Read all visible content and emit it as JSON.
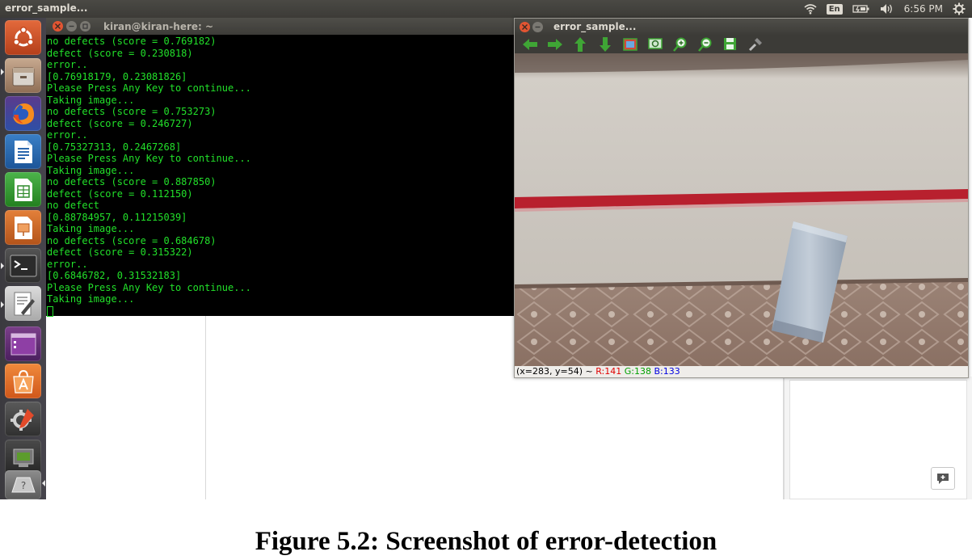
{
  "top_panel": {
    "title": "error_sample...",
    "language": "En",
    "time": "6:56 PM",
    "icons": [
      "wifi-icon",
      "keyboard-icon",
      "battery-icon",
      "volume-icon",
      "settings-gear-icon"
    ]
  },
  "launcher": {
    "items": [
      "ubuntu-dash-icon",
      "files-icon",
      "firefox-icon",
      "writer-icon",
      "calc-icon",
      "impress-icon",
      "terminal-icon",
      "text-editor-icon",
      "workspaces-icon",
      "software-center-icon",
      "system-settings-icon",
      "usb-device-icon",
      "help-icon"
    ]
  },
  "terminal": {
    "title": "kiran@kiran-here: ~",
    "lines": [
      "no defects (score = 0.769182)",
      "defect (score = 0.230818)",
      "error..",
      "[0.76918179, 0.23081826]",
      "Please Press Any Key to continue...",
      "Taking image...",
      "no defects (score = 0.753273)",
      "defect (score = 0.246727)",
      "error..",
      "[0.75327313, 0.2467268]",
      "Please Press Any Key to continue...",
      "Taking image...",
      "no defects (score = 0.887850)",
      "defect (score = 0.112150)",
      "no defect",
      "[0.88784957, 0.11215039]",
      "Taking image...",
      "no defects (score = 0.684678)",
      "defect (score = 0.315322)",
      "error..",
      "[0.6846782, 0.31532183]",
      "Please Press Any Key to continue...",
      "Taking image..."
    ]
  },
  "viewer": {
    "title": "error_sample...",
    "toolbar": [
      "arrow-left-icon",
      "arrow-right-icon",
      "arrow-up-icon",
      "arrow-down-icon",
      "zoom-fit-icon",
      "zoom-original-icon",
      "zoom-in-icon",
      "zoom-out-icon",
      "save-icon",
      "properties-icon"
    ],
    "status": {
      "coords": "(x=283, y=54) ~",
      "r": "R:141",
      "g": "G:138",
      "b": "B:133"
    }
  },
  "caption": "Figure 5.2: Screenshot of error-detection",
  "colors": {
    "terminal_text": "#22e02a",
    "panel": "#3c3b37",
    "close_button": "#e25532",
    "fabric_red_stripe": "#b8202e"
  }
}
